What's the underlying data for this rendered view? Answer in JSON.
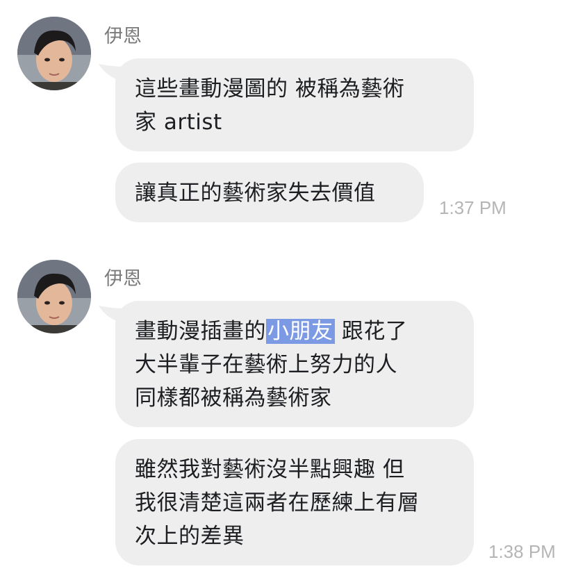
{
  "groups": [
    {
      "sender": "伊恩",
      "messages": [
        {
          "lines": [
            "這些畫動漫圖的  被稱為藝術",
            "家  artist"
          ]
        },
        {
          "lines": [
            "讓真正的藝術家失去價值"
          ]
        }
      ],
      "timestamp": "1:37 PM"
    },
    {
      "sender": "伊恩",
      "messages": [
        {
          "line1_before": "畫動漫插畫的",
          "line1_highlight": "小朋友",
          "line1_after": "  跟花了",
          "lines_rest": [
            "大半輩子在藝術上努力的人",
            "同樣都被稱為藝術家"
          ]
        },
        {
          "lines": [
            "雖然我對藝術沒半點興趣  但",
            "我很清楚這兩者在歷練上有層",
            "次上的差異"
          ]
        }
      ],
      "timestamp": "1:38 PM"
    }
  ],
  "colors": {
    "bubble": "#eeeeee",
    "highlight": "#7c99e4",
    "timestamp": "#b5b5b5",
    "sender": "#7a7a7a"
  }
}
